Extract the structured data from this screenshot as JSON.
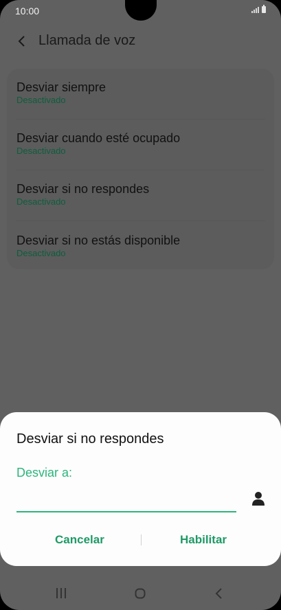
{
  "status_bar": {
    "time": "10:00"
  },
  "app_bar": {
    "title": "Llamada de voz"
  },
  "settings": {
    "items": [
      {
        "title": "Desviar siempre",
        "status": "Desactivado"
      },
      {
        "title": "Desviar cuando esté ocupado",
        "status": "Desactivado"
      },
      {
        "title": "Desviar si no respondes",
        "status": "Desactivado"
      },
      {
        "title": "Desviar si no estás disponible",
        "status": "Desactivado"
      }
    ]
  },
  "dialog": {
    "title": "Desviar si no respondes",
    "field_label": "Desviar a:",
    "field_value": "",
    "cancel_label": "Cancelar",
    "enable_label": "Habilitar"
  },
  "colors": {
    "accent": "#2bb57b",
    "status_green": "#0c5e3e",
    "scrim": "#606060"
  },
  "icons": [
    "back-icon",
    "contact-icon",
    "signal-icon",
    "battery-icon",
    "recent-apps-icon",
    "home-icon",
    "nav-back-icon"
  ]
}
